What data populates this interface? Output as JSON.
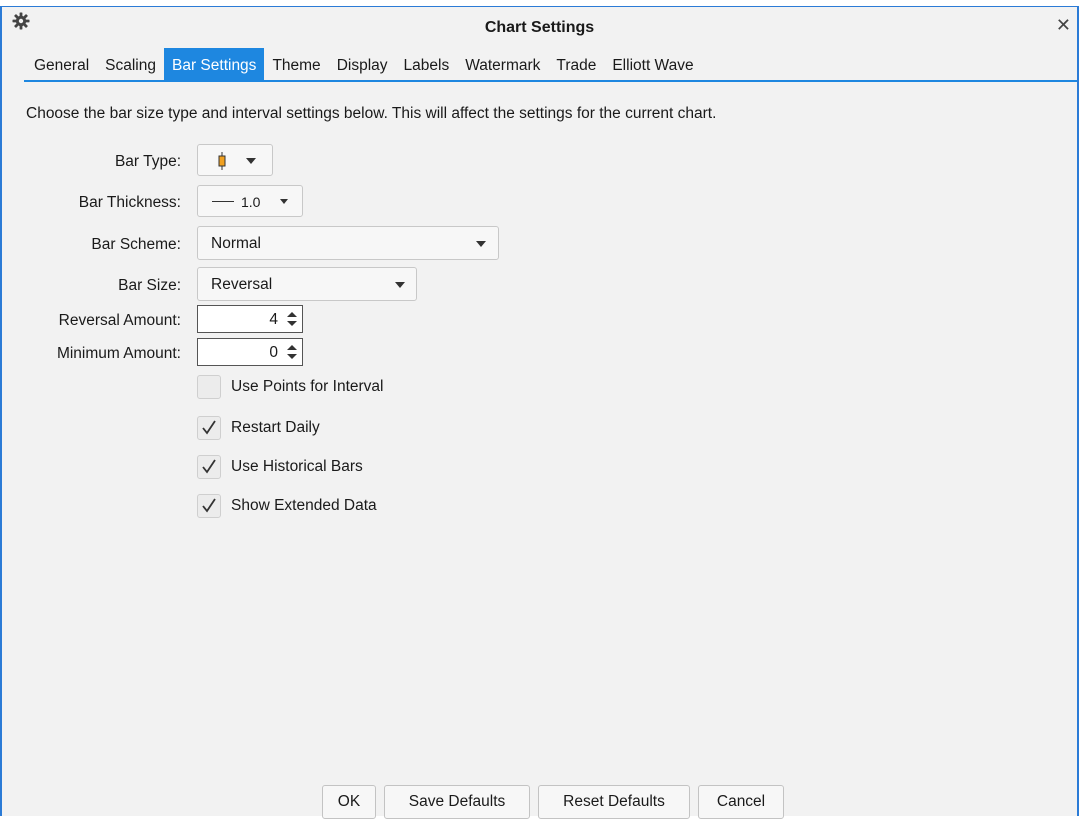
{
  "window": {
    "title": "Chart Settings",
    "gear_icon": "gear-icon",
    "close_glyph": "✕"
  },
  "tabs": [
    {
      "label": "General"
    },
    {
      "label": "Scaling"
    },
    {
      "label": "Bar Settings",
      "active": true
    },
    {
      "label": "Theme"
    },
    {
      "label": "Display"
    },
    {
      "label": "Labels"
    },
    {
      "label": "Watermark"
    },
    {
      "label": "Trade"
    },
    {
      "label": "Elliott Wave"
    }
  ],
  "description": "Choose the bar size type and interval settings below.  This will affect the settings for the current chart.",
  "fields": {
    "bar_type": {
      "label": "Bar Type:",
      "icon": "candlestick-icon"
    },
    "bar_thickness": {
      "label": "Bar Thickness:",
      "value": "1.0"
    },
    "bar_scheme": {
      "label": "Bar Scheme:",
      "value": "Normal"
    },
    "bar_size": {
      "label": "Bar Size:",
      "value": "Reversal"
    },
    "reversal_amount": {
      "label": "Reversal Amount:",
      "value": "4"
    },
    "minimum_amount": {
      "label": "Minimum Amount:",
      "value": "0"
    }
  },
  "checkboxes": [
    {
      "label": "Use Points for Interval",
      "checked": false
    },
    {
      "label": "Restart Daily",
      "checked": true
    },
    {
      "label": "Use Historical Bars",
      "checked": true
    },
    {
      "label": "Show Extended Data",
      "checked": true
    }
  ],
  "buttons": {
    "ok": "OK",
    "save_defaults": "Save Defaults",
    "reset_defaults": "Reset Defaults",
    "cancel": "Cancel"
  },
  "colors": {
    "accent": "#1e87e0",
    "candle": "#f0a020"
  }
}
